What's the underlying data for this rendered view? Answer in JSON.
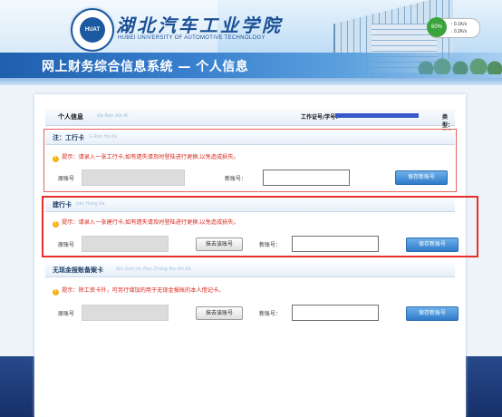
{
  "header": {
    "school_name_cn": "湖北汽车工业学院",
    "school_name_en": "HUBEI UNIVERSITY OF AUTOMOTIVE TECHNOLOGY",
    "logo_text": "HUAT",
    "system_title": "网上财务综合信息系统 — 个人信息",
    "net_widget": {
      "percent": "60%",
      "up": "0.1K/s",
      "down": "0.2K/s"
    }
  },
  "info": {
    "title": "个人信息",
    "title_pinyin": "Ge Ren Xin Xi",
    "id_label": "工作证号/学号：",
    "id_value": "",
    "type_label": "类型：学生"
  },
  "sections": {
    "icbc": {
      "title": "注：工行卡",
      "title_pinyin": "G Ren Ha Ka",
      "tip": "提示：请录入一张工行卡,如有遗失请及时登陆进行更换,以免造成损失。",
      "original_label": "原账号",
      "new_label": "新账号：",
      "save_label": "保存新账号"
    },
    "ccb": {
      "title": "建行卡",
      "title_pinyin": "Jian Hang Ka",
      "tip": "提示：请录入一张建行卡,如有遗失请及时登陆进行更换,以免造成损失。",
      "original_label": "原账号",
      "clear_label": "抹去该账号",
      "new_label": "新账号：",
      "save_label": "保存新账号"
    },
    "cashless": {
      "title": "无现金报账备案卡",
      "title_pinyin": "Wu Xian Jin Bao Zhang Bei An Ka",
      "tip": "提示：除工资卡外，可另行增加的用于无现金报账的本人借记卡。",
      "original_label": "原账号",
      "clear_label": "抹去该账号",
      "new_label": "新账号：",
      "save_label": "保存新账号"
    }
  },
  "colors": {
    "accent": "#2f7bc9",
    "warning": "#d9261c",
    "highlight_border": "#e8302a"
  }
}
